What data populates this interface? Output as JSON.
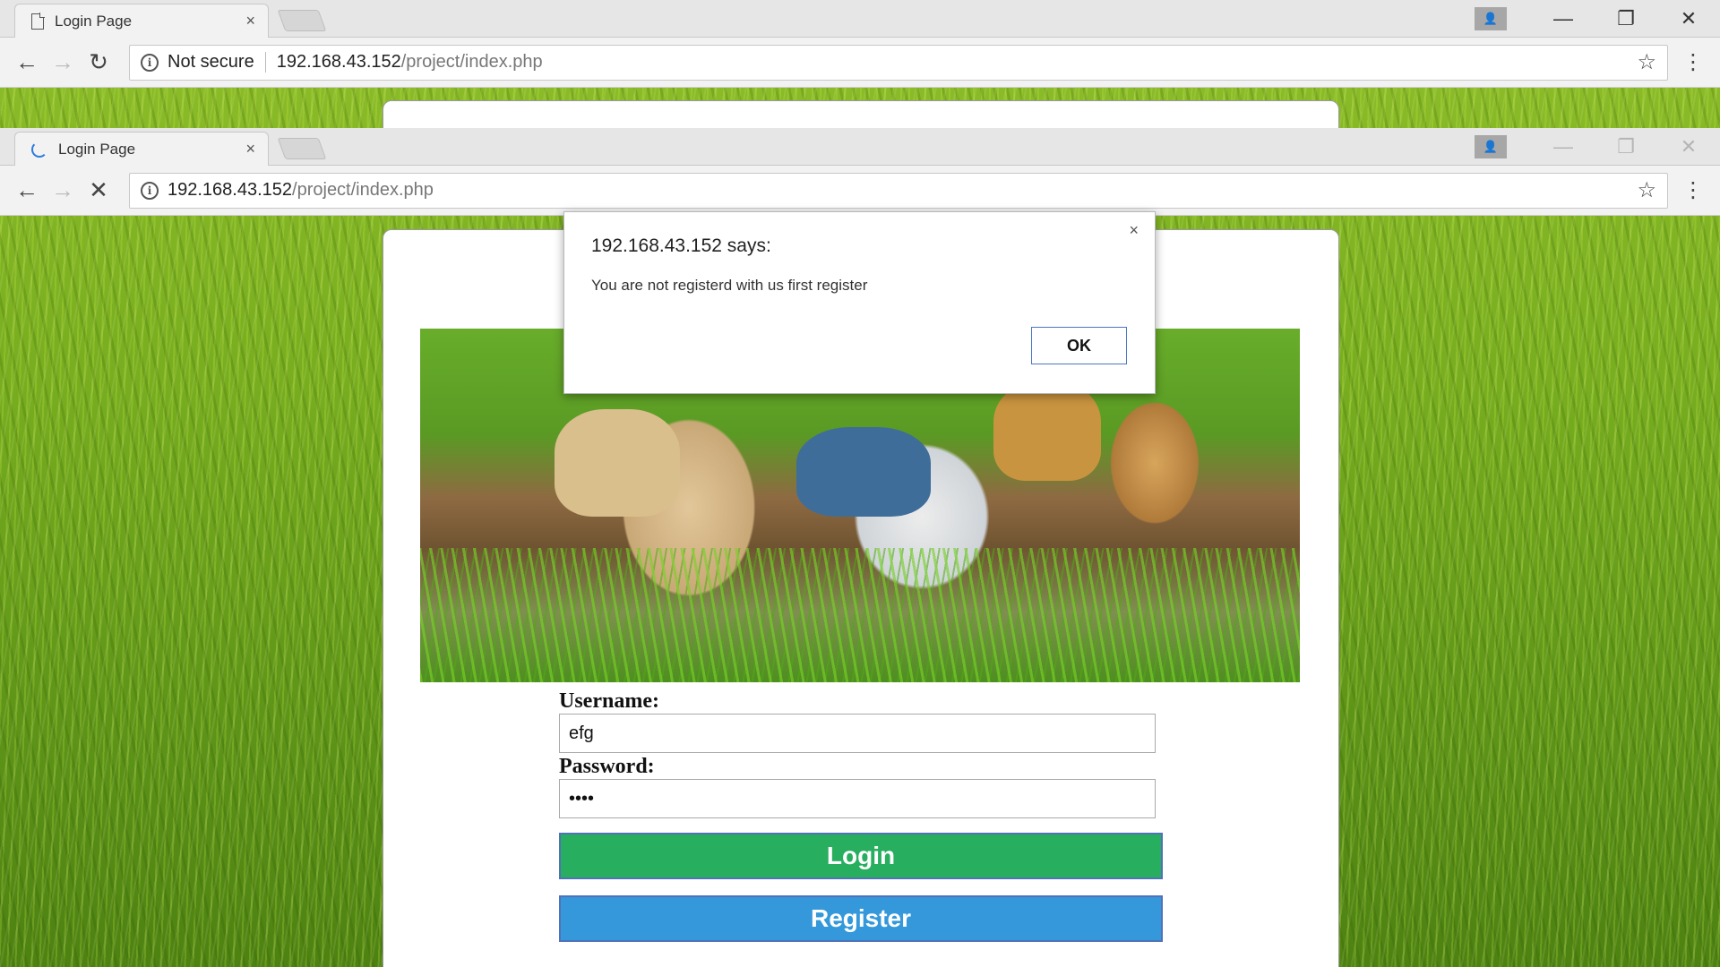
{
  "back_window": {
    "tab_title": "Login Page",
    "tab_close": "×",
    "security_label": "Not secure",
    "url_host": "192.168.43.152",
    "url_path": "/project/index.php"
  },
  "front_window": {
    "tab_title": "Login Page",
    "tab_close": "×",
    "url_host": "192.168.43.152",
    "url_path": "/project/index.php"
  },
  "icons": {
    "back": "←",
    "forward": "→",
    "reload": "↻",
    "stop": "✕",
    "info": "i",
    "star": "☆",
    "menu": "⋮",
    "minimize": "—",
    "restore": "❐",
    "close": "✕",
    "profile": "👤"
  },
  "form": {
    "username_label": "Username:",
    "username_value": "efg",
    "password_label": "Password:",
    "password_value": "••••",
    "login_label": "Login",
    "register_label": "Register"
  },
  "alert": {
    "title": "192.168.43.152 says:",
    "message": "You are not registerd with us first register",
    "close": "×",
    "ok_label": "OK"
  },
  "colors": {
    "login_button": "#27ae5f",
    "register_button": "#3498db",
    "loading_spinner": "#2b7be0"
  }
}
